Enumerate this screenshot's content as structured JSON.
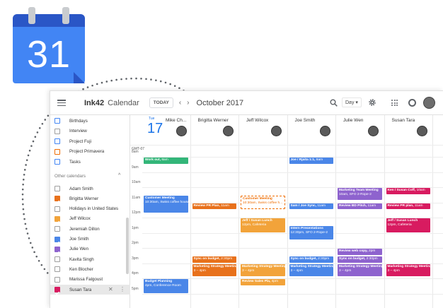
{
  "logo": {
    "day_number": "31"
  },
  "header": {
    "brand": "Ink42",
    "app_name": "Calendar",
    "today_label": "TODAY",
    "prev": "‹",
    "next": "›",
    "month": "October 2017",
    "view": "Day ▾"
  },
  "sidebar": {
    "my_calendars": [
      {
        "label": "Birthdays",
        "checked": false,
        "color": "#4285f4"
      },
      {
        "label": "Interview",
        "checked": false,
        "color": "#9e9e9e"
      },
      {
        "label": "Project Fuji",
        "checked": false,
        "color": "#4285f4"
      },
      {
        "label": "Project Primavera",
        "checked": false,
        "color": "#ef6c00"
      },
      {
        "label": "Tasks",
        "checked": false,
        "color": "#4285f4"
      }
    ],
    "other_title": "Other calendars",
    "other_chevron": "^",
    "other_calendars": [
      {
        "label": "Adam Smith",
        "checked": false,
        "color": "#9e9e9e"
      },
      {
        "label": "Brigitta Werner",
        "checked": true,
        "color": "#e8711b"
      },
      {
        "label": "Holidays in United States",
        "checked": false,
        "color": "#9e9e9e"
      },
      {
        "label": "Jeff Wilcox",
        "checked": true,
        "color": "#f2a33a"
      },
      {
        "label": "Jeremiah Dillon",
        "checked": false,
        "color": "#9e9e9e"
      },
      {
        "label": "Joe Smith",
        "checked": true,
        "color": "#4a86e8"
      },
      {
        "label": "Julie Wen",
        "checked": true,
        "color": "#8e63ce"
      },
      {
        "label": "Kavita Singh",
        "checked": false,
        "color": "#9e9e9e"
      },
      {
        "label": "Ken Blocher",
        "checked": false,
        "color": "#9e9e9e"
      },
      {
        "label": "Marissa Falgoust",
        "checked": false,
        "color": "#9e9e9e"
      },
      {
        "label": "Susan Tara",
        "checked": true,
        "color": "#d81b60"
      }
    ],
    "remove_icon": "✕",
    "more_icon": "⋮"
  },
  "grid": {
    "day_name": "Tue",
    "day_number": "17",
    "timezone": "GMT-07",
    "people": [
      {
        "name": "Mike Ch..."
      },
      {
        "name": "Brigitta Werner"
      },
      {
        "name": "Jeff Wilcox"
      },
      {
        "name": "Joe Smith"
      },
      {
        "name": "Julie Wen"
      },
      {
        "name": "Susan Tara"
      }
    ],
    "times": [
      "8am",
      "9am",
      "10am",
      "11am",
      "12pm",
      "1pm",
      "2pm",
      "3pm",
      "4pm",
      "5pm"
    ],
    "events": [
      {
        "col": 0,
        "title": "Work out,",
        "sub": "8am",
        "inline": true,
        "color": "#33b679"
      },
      {
        "col": 3,
        "title": "Joe / Rjaita 1:1,",
        "sub": "8am",
        "inline": true,
        "color": "#4a86e8"
      },
      {
        "col": 4,
        "title": "Marketing Team Meeting",
        "sub": "10am, SFO 2-Rope-2",
        "inline": false,
        "color": "#8e63ce"
      },
      {
        "col": 5,
        "title": "Ken / Susan Coff,",
        "sub": "10am",
        "inline": true,
        "color": "#d81b60"
      },
      {
        "col": 0,
        "title": "Customer Meeting",
        "sub": "10:30am, Swiss coffee house",
        "inline": false,
        "color": "#4a86e8"
      },
      {
        "col": 1,
        "title": "Review PR Plan,",
        "sub": "11am",
        "inline": true,
        "color": "#e8711b"
      },
      {
        "col": 2,
        "title": "Customer Meeting",
        "sub": "10:30am, Swiss coffee h...",
        "inline": false,
        "color": "outline"
      },
      {
        "col": 3,
        "title": "Sam / Joe Sync,",
        "sub": "11am",
        "inline": true,
        "color": "#4a86e8"
      },
      {
        "col": 4,
        "title": "Review BD Pitch,",
        "sub": "11am",
        "inline": true,
        "color": "#8e63ce"
      },
      {
        "col": 5,
        "title": "Review PR plan,",
        "sub": "11am",
        "inline": true,
        "color": "#d81b60"
      },
      {
        "col": 2,
        "title": "Jeff / Susan Lunch",
        "sub": "12pm, Cafeteria",
        "inline": false,
        "color": "#f2a33a"
      },
      {
        "col": 5,
        "title": "Jeff / Susan Lunch",
        "sub": "12pm, Cafeteria",
        "inline": false,
        "color": "#d81b60"
      },
      {
        "col": 3,
        "title": "Intern Presentations",
        "sub": "12:30pm, SFO 2-Rope-2",
        "inline": false,
        "color": "#4a86e8"
      },
      {
        "col": 4,
        "title": "Review web copy,",
        "sub": "2pm",
        "inline": true,
        "color": "#8e63ce"
      },
      {
        "col": 1,
        "title": "Sync on budget,",
        "sub": "2:30pm",
        "inline": true,
        "color": "#e8711b"
      },
      {
        "col": 3,
        "title": "Sync on budget,",
        "sub": "2:30pm",
        "inline": true,
        "color": "#4a86e8"
      },
      {
        "col": 4,
        "title": "Sync on budget,",
        "sub": "2:30pm",
        "inline": true,
        "color": "#8e63ce"
      },
      {
        "col": 1,
        "title": "Marketing Strategy Meeting",
        "sub": "3 – 4pm",
        "inline": false,
        "color": "#e8711b"
      },
      {
        "col": 2,
        "title": "Marketing Strategy Meeting",
        "sub": "3 – 4pm",
        "inline": false,
        "color": "#f2a33a"
      },
      {
        "col": 3,
        "title": "Marketing Strategy Meeting",
        "sub": "3 – 4pm",
        "inline": false,
        "color": "#4a86e8"
      },
      {
        "col": 4,
        "title": "Marketing Strategy Meeting",
        "sub": "3 – 4pm",
        "inline": false,
        "color": "#8e63ce"
      },
      {
        "col": 5,
        "title": "Marketing Strategy Meeting",
        "sub": "3 – 4pm",
        "inline": false,
        "color": "#d81b60"
      },
      {
        "col": 0,
        "title": "Budget Planning",
        "sub": "4pm, Conference Room",
        "inline": false,
        "color": "#4a86e8"
      },
      {
        "col": 2,
        "title": "Review Sales Pla,",
        "sub": "4pm",
        "inline": true,
        "color": "#f2a33a"
      }
    ]
  }
}
